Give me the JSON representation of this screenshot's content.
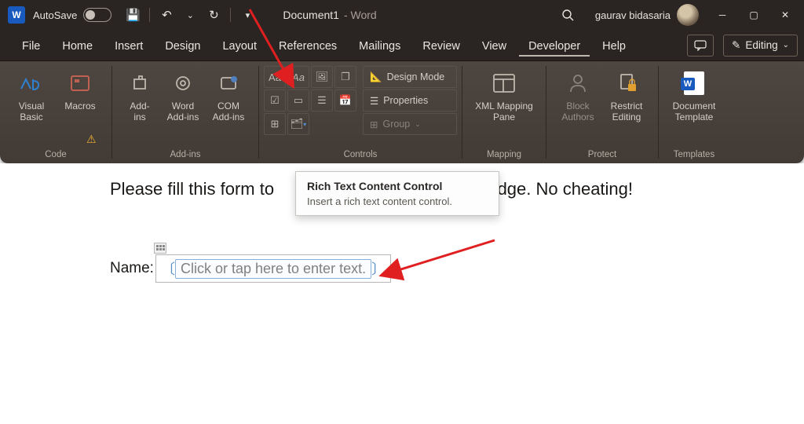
{
  "titlebar": {
    "autosave_label": "AutoSave",
    "doc_title": "Document1",
    "doc_app": " - Word",
    "username": "gaurav bidasaria"
  },
  "menu": {
    "tabs": [
      "File",
      "Home",
      "Insert",
      "Design",
      "Layout",
      "References",
      "Mailings",
      "Review",
      "View",
      "Developer",
      "Help"
    ],
    "active": "Developer",
    "editing_label": "Editing"
  },
  "ribbon": {
    "code": {
      "visual_basic": "Visual\nBasic",
      "macros": "Macros",
      "label": "Code"
    },
    "addins": {
      "addins": "Add-\nins",
      "word": "Word\nAdd-ins",
      "com": "COM\nAdd-ins",
      "label": "Add-ins"
    },
    "controls": {
      "design_mode": "Design Mode",
      "properties": "Properties",
      "group": "Group",
      "label": "Controls"
    },
    "mapping": {
      "xml": "XML Mapping\nPane",
      "label": "Mapping"
    },
    "protect": {
      "block": "Block\nAuthors",
      "restrict": "Restrict\nEditing",
      "label": "Protect"
    },
    "templates": {
      "doc_template": "Document\nTemplate",
      "label": "Templates"
    }
  },
  "tooltip": {
    "title": "Rich Text Content Control",
    "desc": "Insert a rich text content control."
  },
  "document": {
    "form_text_start": "Please fill this form to",
    "form_text_end": "edge. No cheating!",
    "name_label": "Name:",
    "placeholder": "Click or tap here to enter text."
  }
}
